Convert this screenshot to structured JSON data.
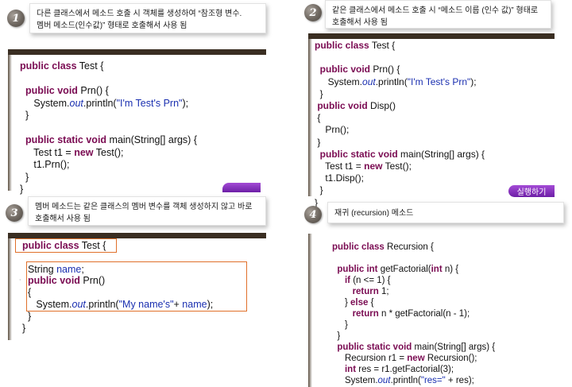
{
  "panels": [
    {
      "badge": "1",
      "note_line1": "다른 클래스에서 메소드 호출 시 객체를 생성하여 “참조형 변수.",
      "note_line2": "멤버 메소드(인수값)” 형태로 호출해서 사용 됨",
      "code": [
        "public class Test {",
        "",
        "  public void Prn() {",
        "     System.out.println(\"I'm Test's Prn\");",
        "  }",
        "",
        "  public static void main(String[] args) {",
        "     Test t1 = new Test();",
        "     t1.Prn();",
        "  }",
        "}"
      ]
    },
    {
      "badge": "2",
      "note_line1": "같은 클래스에서 메소드 호출 시 “메소드 이름 (인수 값)” 형태로",
      "note_line2": "호출해서 사용 됨",
      "run_label": "실행하기",
      "code": [
        "public class Test {",
        "",
        "  public void Prn() {",
        "     System.out.println(\"I'm Test's Prn\");",
        "  }",
        " public void Disp()",
        " {",
        "    Prn();",
        " }",
        "  public static void main(String[] args) {",
        "    Test t1 = new Test();",
        "    t1.Disp();",
        "  }",
        "}"
      ]
    },
    {
      "badge": "3",
      "note_line1": "멤버 메소드는 같은 클래스의 멤버 변수를 객체 생성하지 않고 바로",
      "note_line2": "호출해서 사용 됨",
      "code": [
        "public class Test {",
        "",
        "  String name;",
        "  public void Prn()",
        "  {",
        "     System.out.println(\"My name's\"+ name);",
        "  }",
        "}"
      ]
    },
    {
      "badge": "4",
      "note_line1": "재귀 (recursion) 메소드",
      "code": [
        "public class Recursion {",
        "",
        "  public int getFactorial(int n) {",
        "     if (n <= 1) {",
        "        return 1;",
        "     } else {",
        "        return n * getFactorial(n - 1);",
        "     }",
        "  }",
        "  public static void main(String[] args) {",
        "     Recursion r1 = new Recursion();",
        "     int res = r1.getFactorial(3);",
        "     System.out.println(\"res=\" + res);",
        "  }"
      ]
    }
  ]
}
